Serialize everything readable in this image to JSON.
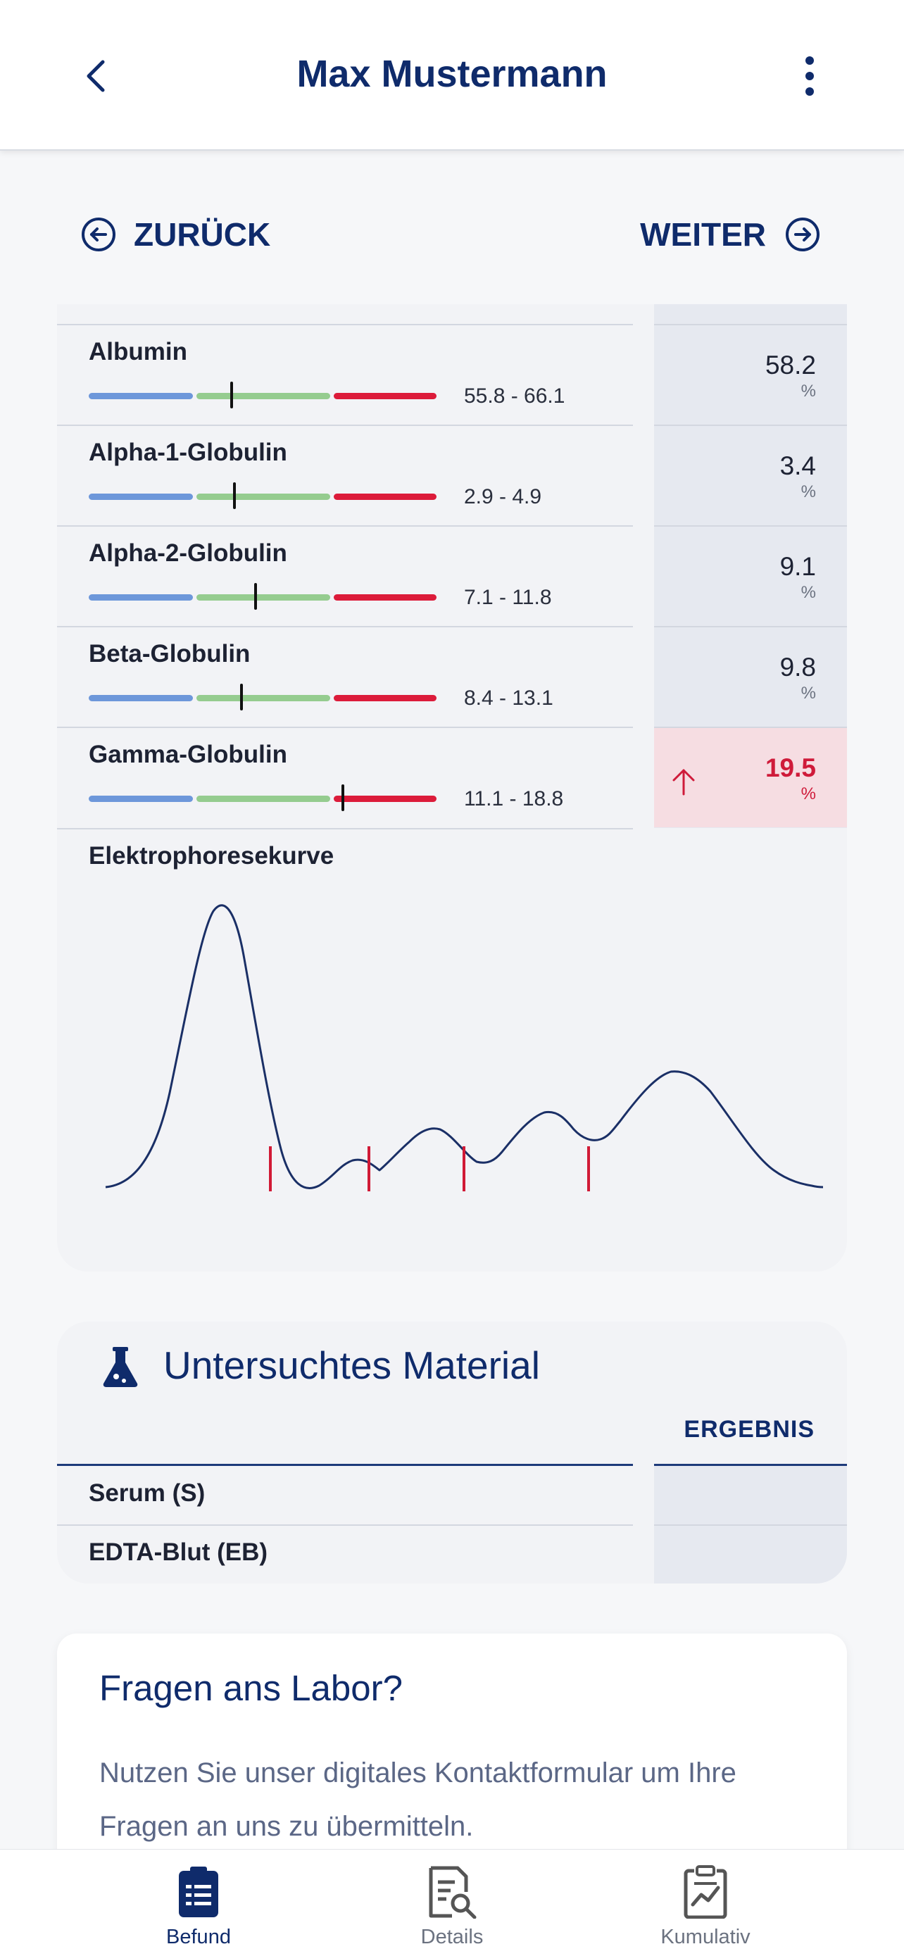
{
  "header": {
    "title": "Max Mustermann",
    "back_icon": "chevron-left-icon",
    "menu_icon": "more-vertical-icon"
  },
  "nav": {
    "prev_label": "ZURÜCK",
    "next_label": "WEITER"
  },
  "results": [
    {
      "name": "Albumin",
      "range": "55.8 - 66.1",
      "value": "58.2",
      "unit": "%",
      "marker_fraction": 0.41
    },
    {
      "name": "Alpha-1-Globulin",
      "range": "2.9 - 4.9",
      "value": "3.4",
      "unit": "%",
      "marker_fraction": 0.42
    },
    {
      "name": "Alpha-2-Globulin",
      "range": "7.1 - 11.8",
      "value": "9.1",
      "unit": "%",
      "marker_fraction": 0.48
    },
    {
      "name": "Beta-Globulin",
      "range": "8.4 - 13.1",
      "value": "9.8",
      "unit": "%",
      "marker_fraction": 0.44
    },
    {
      "name": "Gamma-Globulin",
      "range": "11.1 - 18.8",
      "value": "19.5",
      "unit": "%",
      "marker_fraction": 0.73,
      "flag": "high"
    }
  ],
  "curve": {
    "label": "Elektrophoresekurve"
  },
  "material": {
    "title": "Untersuchtes Material",
    "column_header": "ERGEBNIS",
    "rows": [
      "Serum (S)",
      "EDTA-Blut (EB)"
    ]
  },
  "contact": {
    "title": "Fragen ans Labor?",
    "body": "Nutzen Sie unser digitales Kontaktformular um Ihre Fragen an uns zu übermitteln."
  },
  "tabs": [
    {
      "label": "Befund",
      "icon": "report-icon",
      "active": true
    },
    {
      "label": "Details",
      "icon": "document-search-icon",
      "active": false
    },
    {
      "label": "Kumulativ",
      "icon": "clipboard-chart-icon",
      "active": false
    }
  ],
  "colors": {
    "brand": "#0f2b6b",
    "low": "#6d97da",
    "normal": "#95cc8f",
    "high": "#dc1b3a"
  }
}
